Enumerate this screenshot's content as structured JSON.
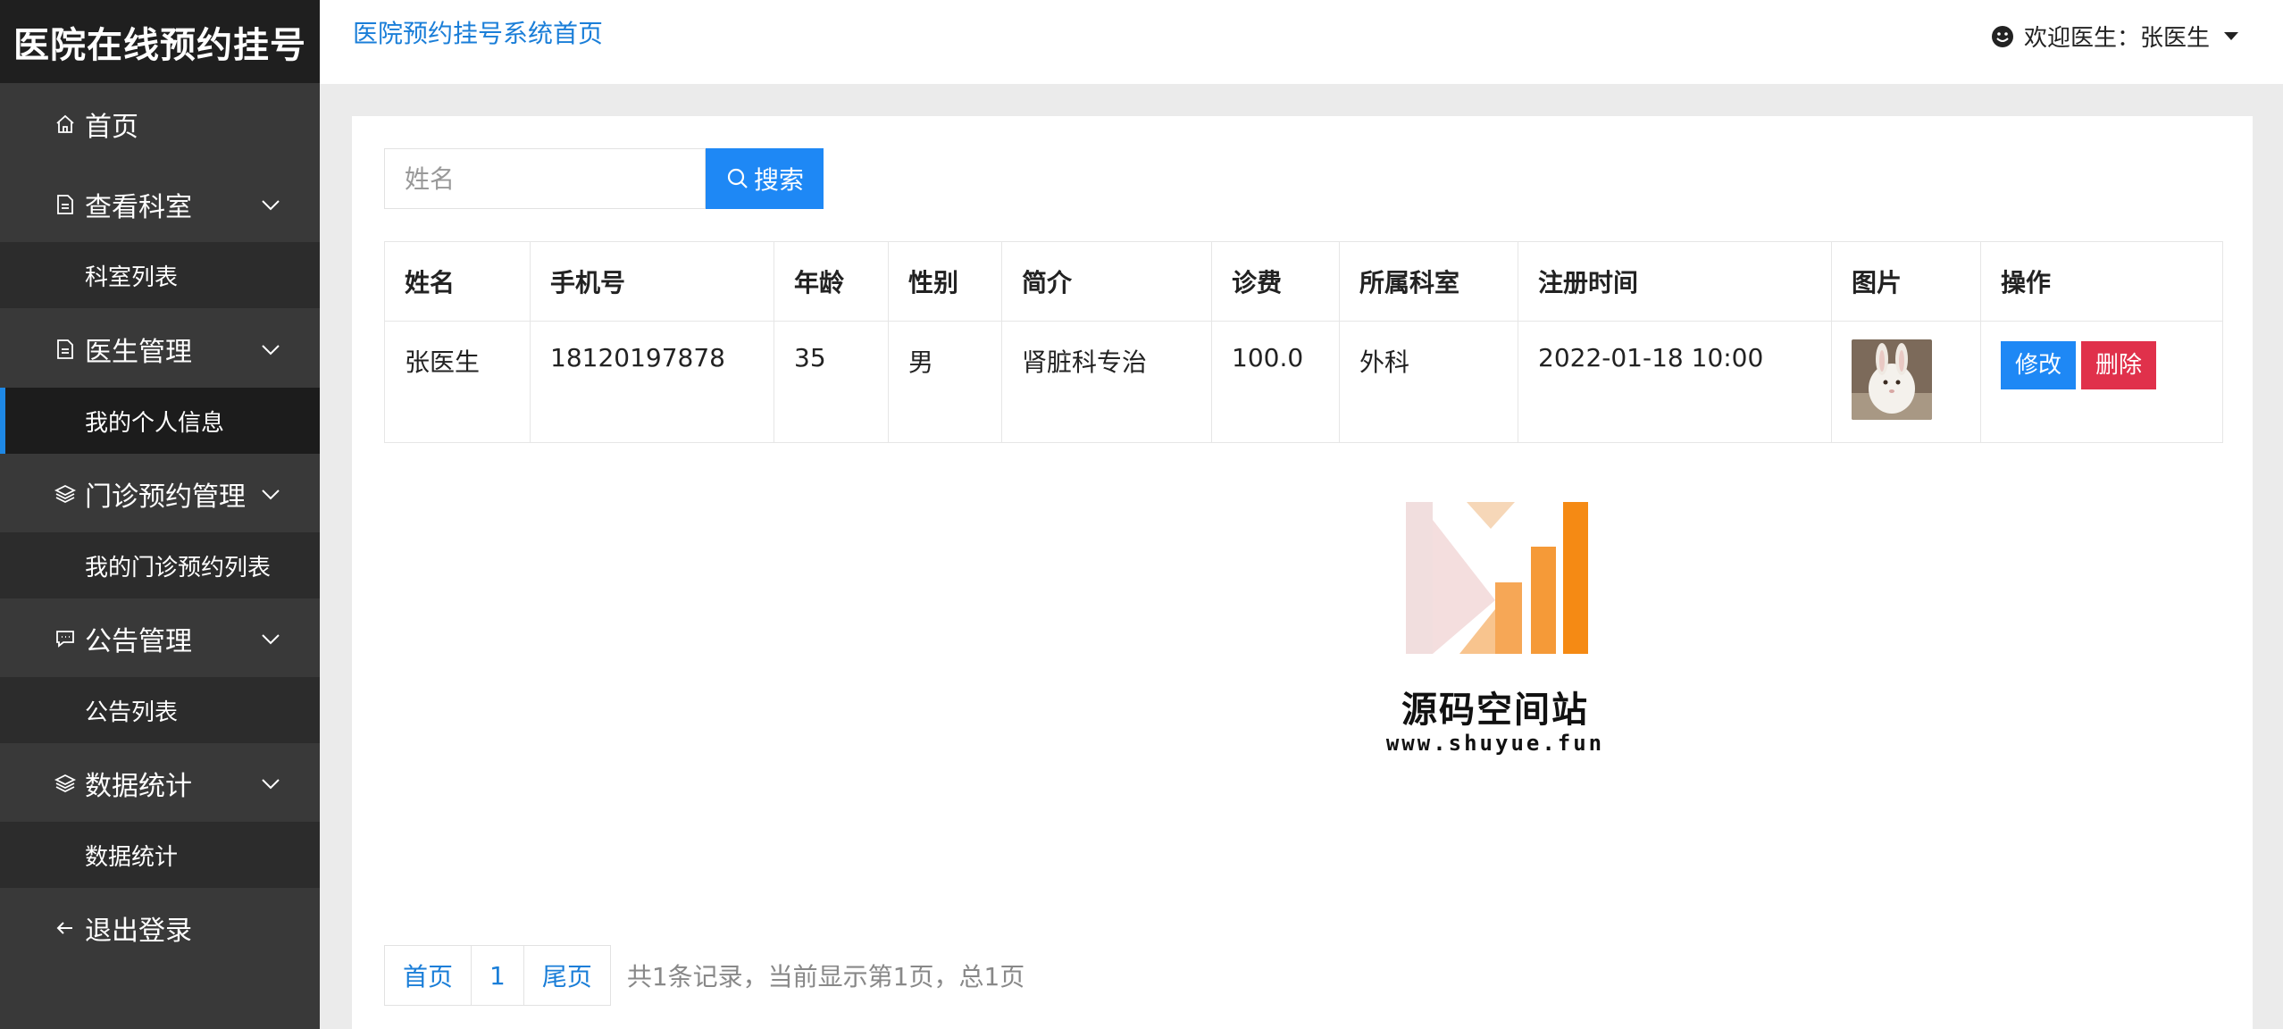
{
  "app": {
    "title": "医院在线预约挂号"
  },
  "header": {
    "home_link": "医院预约挂号系统首页",
    "user_greeting": "欢迎医生：张医生"
  },
  "sidebar": {
    "items": [
      {
        "label": "首页",
        "icon": "home-icon"
      },
      {
        "label": "查看科室",
        "icon": "document-icon",
        "sub": [
          "科室列表"
        ]
      },
      {
        "label": "医生管理",
        "icon": "document-icon",
        "sub": [
          "我的个人信息"
        ],
        "active_sub": "我的个人信息"
      },
      {
        "label": "门诊预约管理",
        "icon": "layers-icon",
        "sub": [
          "我的门诊预约列表"
        ]
      },
      {
        "label": "公告管理",
        "icon": "message-icon",
        "sub": [
          "公告列表"
        ]
      },
      {
        "label": "数据统计",
        "icon": "layers-icon",
        "sub": [
          "数据统计"
        ]
      },
      {
        "label": "退出登录",
        "icon": "arrow-left-icon"
      }
    ]
  },
  "search": {
    "placeholder": "姓名",
    "button_label": "搜索"
  },
  "table": {
    "headers": [
      "姓名",
      "手机号",
      "年龄",
      "性别",
      "简介",
      "诊费",
      "所属科室",
      "注册时间",
      "图片",
      "操作"
    ],
    "rows": [
      [
        "张医生",
        "18120197878",
        "35",
        "男",
        "肾脏科专治",
        "100.0",
        "外科",
        "2022-01-18 10:00"
      ]
    ],
    "edit_label": "修改",
    "delete_label": "删除"
  },
  "pagination": {
    "first": "首页",
    "page": "1",
    "last": "尾页",
    "info": "共1条记录，当前显示第1页，总1页"
  },
  "watermark": {
    "title": "源码空间站",
    "url": "www.shuyue.fun"
  },
  "colors": {
    "accent": "#1e88f5",
    "danger": "#e0314b",
    "sidebar": "#393939",
    "sidebar_sub": "#2c2c2c"
  }
}
